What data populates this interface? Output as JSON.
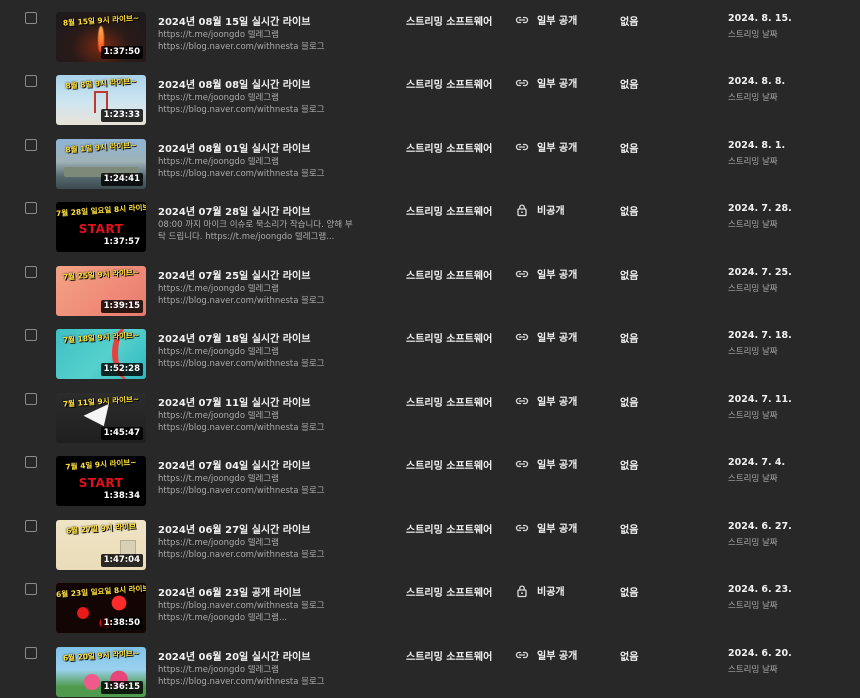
{
  "rows": [
    {
      "thumb_caption": "8월 15일 9시 라이브~",
      "thumb_big": "",
      "duration": "1:37:50",
      "title": "2024년 08월 15일 실시간 라이브",
      "desc1": "https://t.me/joongdo 텔레그램",
      "desc2": "https://blog.naver.com/withnesta 블로그",
      "source": "스트리밍 소프트웨어",
      "visibility": "일부 공개",
      "vis_icon": "link-icon",
      "restrictions": "없음",
      "date": "2024. 8. 15.",
      "date_label": "스트리밍 날짜"
    },
    {
      "thumb_caption": "8월 8일 9시 라이브~",
      "thumb_big": "",
      "duration": "1:23:33",
      "title": "2024년 08월 08일 실시간 라이브",
      "desc1": "https://t.me/joongdo 텔레그램",
      "desc2": "https://blog.naver.com/withnesta 블로그",
      "source": "스트리밍 소프트웨어",
      "visibility": "일부 공개",
      "vis_icon": "link-icon",
      "restrictions": "없음",
      "date": "2024. 8. 8.",
      "date_label": "스트리밍 날짜"
    },
    {
      "thumb_caption": "8월 1일 9시 라이브~",
      "thumb_big": "",
      "duration": "1:24:41",
      "title": "2024년 08월 01일 실시간 라이브",
      "desc1": "https://t.me/joongdo 텔레그램",
      "desc2": "https://blog.naver.com/withnesta 블로그",
      "source": "스트리밍 소프트웨어",
      "visibility": "일부 공개",
      "vis_icon": "link-icon",
      "restrictions": "없음",
      "date": "2024. 8. 1.",
      "date_label": "스트리밍 날짜"
    },
    {
      "thumb_caption": "7월 28일 일요일 8시 라이브~",
      "thumb_big": "START",
      "duration": "1:37:57",
      "title": "2024년 07월 28일 실시간 라이브",
      "desc1": "08:00 까지 마이크 이슈로 묵소리가 작습니다. 양해 부",
      "desc2": "탁 드립니다. https://t.me/joongdo 텔레그램...",
      "source": "스트리밍 소프트웨어",
      "visibility": "비공개",
      "vis_icon": "lock-icon",
      "restrictions": "없음",
      "date": "2024. 7. 28.",
      "date_label": "스트리밍 날짜"
    },
    {
      "thumb_caption": "7월 25일 9시 라이브~",
      "thumb_big": "",
      "duration": "1:39:15",
      "title": "2024년 07월 25일 실시간 라이브",
      "desc1": "https://t.me/joongdo 텔레그램",
      "desc2": "https://blog.naver.com/withnesta 블로그",
      "source": "스트리밍 소프트웨어",
      "visibility": "일부 공개",
      "vis_icon": "link-icon",
      "restrictions": "없음",
      "date": "2024. 7. 25.",
      "date_label": "스트리밍 날짜"
    },
    {
      "thumb_caption": "7월 18일 9시 라이브~",
      "thumb_big": "",
      "duration": "1:52:28",
      "title": "2024년 07월 18일 실시간 라이브",
      "desc1": "https://t.me/joongdo 텔레그램",
      "desc2": "https://blog.naver.com/withnesta 블로그",
      "source": "스트리밍 소프트웨어",
      "visibility": "일부 공개",
      "vis_icon": "link-icon",
      "restrictions": "없음",
      "date": "2024. 7. 18.",
      "date_label": "스트리밍 날짜"
    },
    {
      "thumb_caption": "7월 11일 9시 라이브~",
      "thumb_big": "",
      "duration": "1:45:47",
      "title": "2024년 07월 11일 실시간 라이브",
      "desc1": "https://t.me/joongdo 텔레그램",
      "desc2": "https://blog.naver.com/withnesta 블로그",
      "source": "스트리밍 소프트웨어",
      "visibility": "일부 공개",
      "vis_icon": "link-icon",
      "restrictions": "없음",
      "date": "2024. 7. 11.",
      "date_label": "스트리밍 날짜"
    },
    {
      "thumb_caption": "7월 4일 9시 라이브~",
      "thumb_big": "START",
      "duration": "1:38:34",
      "title": "2024년 07월 04일 실시간 라이브",
      "desc1": "https://t.me/joongdo 텔레그램",
      "desc2": "https://blog.naver.com/withnesta 블로그",
      "source": "스트리밍 소프트웨어",
      "visibility": "일부 공개",
      "vis_icon": "link-icon",
      "restrictions": "없음",
      "date": "2024. 7. 4.",
      "date_label": "스트리밍 날짜"
    },
    {
      "thumb_caption": "6월 27일 9시 라이브",
      "thumb_big": "",
      "duration": "1:47:04",
      "title": "2024년 06월 27일 실시간 라이브",
      "desc1": "https://t.me/joongdo 텔레그램",
      "desc2": "https://blog.naver.com/withnesta 블로그",
      "source": "스트리밍 소프트웨어",
      "visibility": "일부 공개",
      "vis_icon": "link-icon",
      "restrictions": "없음",
      "date": "2024. 6. 27.",
      "date_label": "스트리밍 날짜"
    },
    {
      "thumb_caption": "6월 23일 일요일 8시 라이브~",
      "thumb_big": "",
      "duration": "1:38:50",
      "title": "2024년 06월 23일 공개 라이브",
      "desc1": "https://blog.naver.com/withnesta 블로그",
      "desc2": "https://t.me/joongdo 텔레그램...",
      "source": "스트리밍 소프트웨어",
      "visibility": "비공개",
      "vis_icon": "lock-icon",
      "restrictions": "없음",
      "date": "2024. 6. 23.",
      "date_label": "스트리밍 날짜"
    },
    {
      "thumb_caption": "6월 20일 9시 라이브~",
      "thumb_big": "",
      "duration": "1:36:15",
      "title": "2024년 06월 20일 실시간 라이브",
      "desc1": "https://t.me/joongdo 텔레그램",
      "desc2": "https://blog.naver.com/withnesta 블로그",
      "source": "스트리밍 소프트웨어",
      "visibility": "일부 공개",
      "vis_icon": "link-icon",
      "restrictions": "없음",
      "date": "2024. 6. 20.",
      "date_label": "스트리밍 날짜"
    }
  ]
}
